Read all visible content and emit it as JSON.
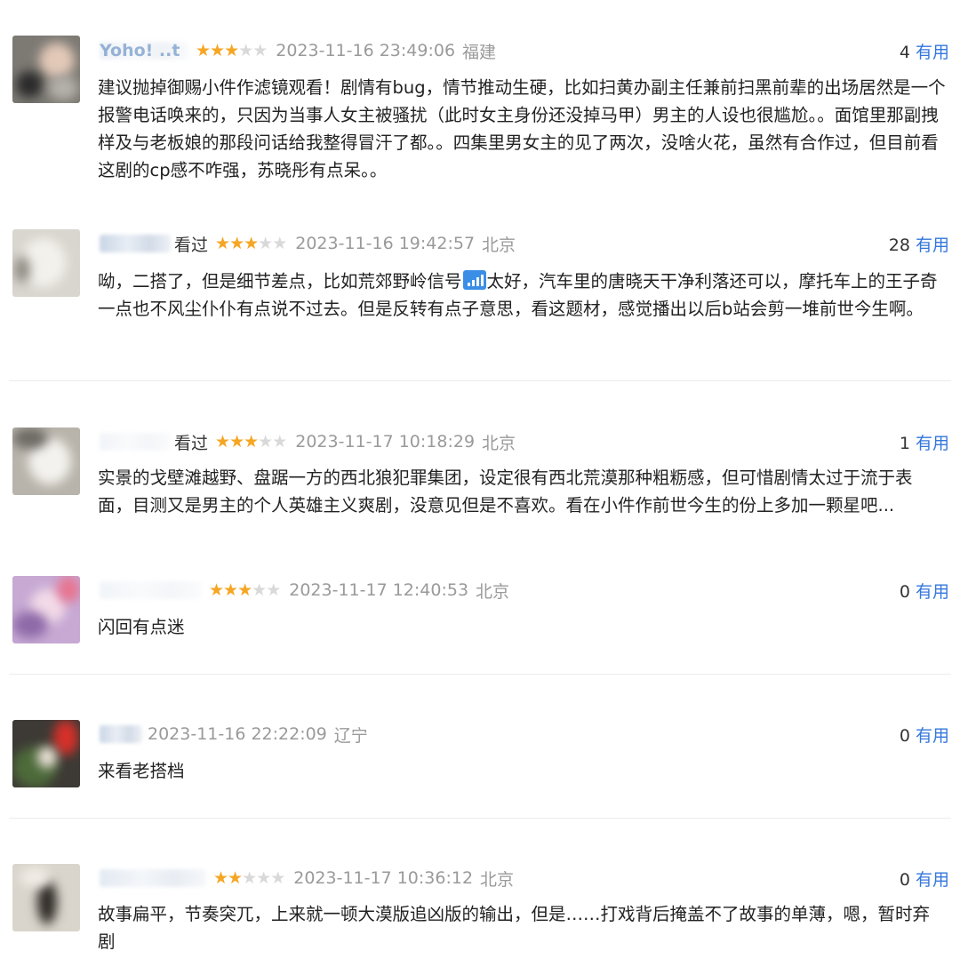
{
  "useful_label": "有用",
  "comments": [
    {
      "user": "Yoho! ..t",
      "status": "",
      "stars": 3,
      "time": "2023-11-16 23:49:06",
      "location": "福建",
      "useful": "4",
      "content": "建议抛掉御赐小件作滤镜观看！剧情有bug，情节推动生硬，比如扫黄办副主任兼前扫黑前辈的出场居然是一个报警电话唤来的，只因为当事人女主被骚扰（此时女主身份还没掉马甲）男主的人设也很尴尬。。面馆里那副拽样及与老板娘的那段问话给我整得冒汗了都。。四集里男女主的见了两次，没啥火花，虽然有合作过，但目前看这剧的cp感不咋强，苏晓彤有点呆。。"
    },
    {
      "user": "",
      "status": "看过",
      "stars": 3,
      "time": "2023-11-16 19:42:57",
      "location": "北京",
      "useful": "28",
      "content_a": "呦，二搭了，但是细节差点，比如荒郊野岭信号",
      "content_b": "太好，汽车里的唐晓天干净利落还可以，摩托车上的王子奇一点也不风尘仆仆有点说不过去。但是反转有点子意思，看这题材，感觉播出以后b站会剪一堆前世今生啊。"
    },
    {
      "user": "",
      "status": "看过",
      "stars": 3,
      "time": "2023-11-17 10:18:29",
      "location": "北京",
      "useful": "1",
      "content": "实景的戈壁滩越野、盘踞一方的西北狼犯罪集团，设定很有西北荒漠那种粗粝感，但可惜剧情太过于流于表面，目测又是男主的个人英雄主义爽剧，没意见但是不喜欢。看在小件作前世今生的份上多加一颗星吧..."
    },
    {
      "user": "",
      "status": "",
      "stars": 3,
      "time": "2023-11-17 12:40:53",
      "location": "北京",
      "useful": "0",
      "content": "闪回有点迷"
    },
    {
      "user": "",
      "status": "",
      "stars": 0,
      "time": "2023-11-16 22:22:09",
      "location": "辽宁",
      "useful": "0",
      "content": "来看老搭档"
    },
    {
      "user": "",
      "status": "",
      "stars": 2,
      "time": "2023-11-17 10:36:12",
      "location": "北京",
      "useful": "0",
      "content": "故事扁平，节奏突兀，上来就一顿大漠版追凶版的输出，但是……打戏背后掩盖不了故事的单薄，嗯，暂时弃剧"
    }
  ]
}
